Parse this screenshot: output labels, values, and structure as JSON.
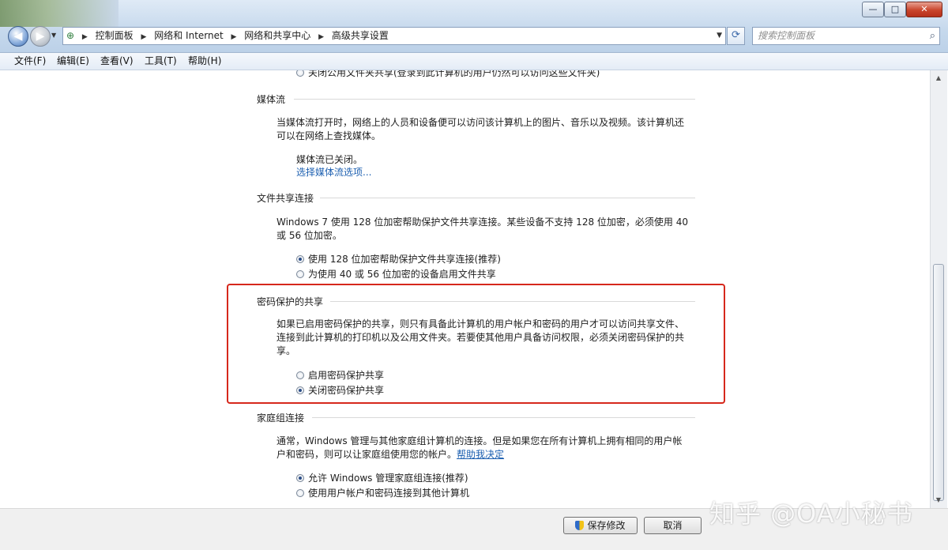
{
  "window": {
    "minimize": "—",
    "maximize": "□",
    "close": "✕"
  },
  "address": {
    "crumbs": [
      "控制面板",
      "网络和 Internet",
      "网络和共享中心",
      "高级共享设置"
    ]
  },
  "search": {
    "placeholder": "搜索控制面板"
  },
  "menu": [
    "文件(F)",
    "编辑(E)",
    "查看(V)",
    "工具(T)",
    "帮助(H)"
  ],
  "content": {
    "top_cut_radio": "关闭公用文件夹共享(登录到此计算机的用户仍然可以访问这些文件夹)",
    "media": {
      "title": "媒体流",
      "desc": "当媒体流打开时，网络上的人员和设备便可以访问该计算机上的图片、音乐以及视频。该计算机还可以在网络上查找媒体。",
      "status": "媒体流已关闭。",
      "link": "选择媒体流选项..."
    },
    "fileshare": {
      "title": "文件共享连接",
      "desc": "Windows 7 使用 128 位加密帮助保护文件共享连接。某些设备不支持 128 位加密，必须使用 40 或 56 位加密。",
      "options": [
        "使用 128 位加密帮助保护文件共享连接(推荐)",
        "为使用 40 或 56 位加密的设备启用文件共享"
      ]
    },
    "password": {
      "title": "密码保护的共享",
      "desc": "如果已启用密码保护的共享，则只有具备此计算机的用户帐户和密码的用户才可以访问共享文件、连接到此计算机的打印机以及公用文件夹。若要使其他用户具备访问权限，必须关闭密码保护的共享。",
      "options": [
        "启用密码保护共享",
        "关闭密码保护共享"
      ]
    },
    "homegroup": {
      "title": "家庭组连接",
      "desc": "通常，Windows 管理与其他家庭组计算机的连接。但是如果您在所有计算机上拥有相同的用户帐户和密码，则可以让家庭组使用您的帐户。",
      "help_link": "帮助我决定",
      "options": [
        "允许 Windows 管理家庭组连接(推荐)",
        "使用用户帐户和密码连接到其他计算机"
      ]
    }
  },
  "buttons": {
    "save": "保存修改",
    "cancel": "取消"
  },
  "watermark": "知乎 @OA小秘书"
}
